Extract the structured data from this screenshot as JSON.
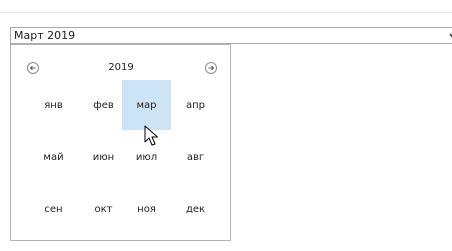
{
  "field": {
    "value": "Март 2019",
    "dropdown_icon": "chevron-down-icon"
  },
  "picker": {
    "year": "2019",
    "prev_icon": "circle-arrow-left-icon",
    "next_icon": "circle-arrow-right-icon",
    "selected_month": "мар",
    "selection_color": "#cde4f7",
    "months": [
      "янв",
      "фев",
      "мар",
      "апр",
      "май",
      "июн",
      "июл",
      "авг",
      "сен",
      "окт",
      "ноя",
      "дек"
    ]
  }
}
